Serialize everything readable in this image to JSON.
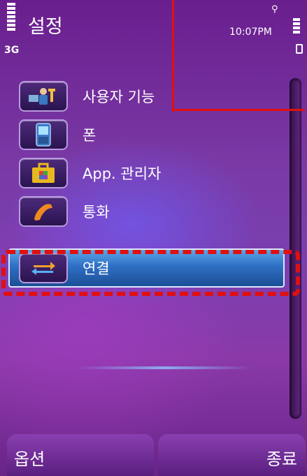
{
  "status_bar": {
    "title": "설정",
    "network": "3G",
    "time": "10:07PM"
  },
  "menu": {
    "items": [
      {
        "label": "사용자 기능",
        "icon": "user-settings-icon"
      },
      {
        "label": "폰",
        "icon": "phone-icon"
      },
      {
        "label": "App. 관리자",
        "icon": "app-manager-icon"
      },
      {
        "label": "통화",
        "icon": "call-icon"
      },
      {
        "label": "연결",
        "icon": "connectivity-icon",
        "selected": true
      }
    ]
  },
  "softkeys": {
    "left": "옵션",
    "right": "종료"
  },
  "colors": {
    "selection": "#2f6fc4",
    "annotation": "#e01010"
  }
}
